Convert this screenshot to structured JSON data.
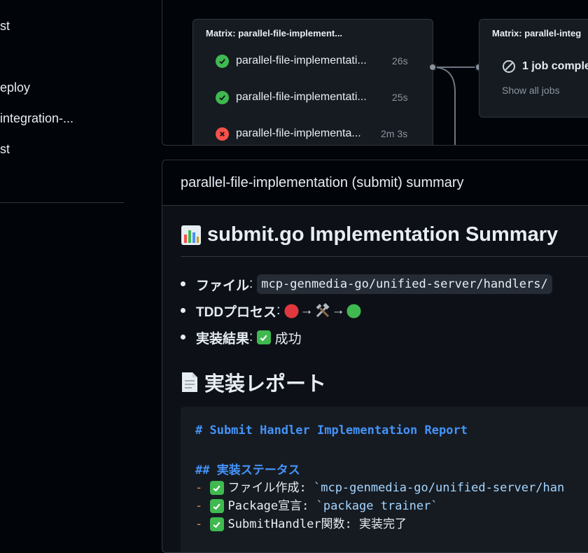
{
  "sidebar": {
    "items": [
      "st",
      "eploy",
      "integration-...",
      "st"
    ]
  },
  "graph": {
    "matrix1": {
      "title": "Matrix: parallel-file-implement...",
      "jobs": [
        {
          "name": "parallel-file-implementati...",
          "time": "26s",
          "status": "success"
        },
        {
          "name": "parallel-file-implementati...",
          "time": "25s",
          "status": "success"
        },
        {
          "name": "parallel-file-implementa...",
          "time": "2m 3s",
          "status": "failure"
        }
      ]
    },
    "matrix2": {
      "title": "Matrix: parallel-integ",
      "job_label": "1 job comple",
      "show_all": "Show all jobs"
    }
  },
  "summary": {
    "header": "parallel-file-implementation (submit) summary",
    "title": "submit.go Implementation Summary",
    "bullets": [
      {
        "label": "ファイル",
        "code": "mcp-genmedia-go/unified-server/handlers/"
      },
      {
        "label": "TDDプロセス",
        "value": "→ →"
      },
      {
        "label": "実装結果",
        "value": "成功"
      }
    ],
    "section_title": "実装レポート",
    "code": {
      "line1": "# Submit Handler Implementation Report",
      "line2": "## 実装ステータス",
      "line3_label": "ファイル作成: ",
      "line3_value": "`mcp-genmedia-go/unified-server/han",
      "line4_label": "Package宣言: ",
      "line4_value": "`package trainer`",
      "line5_label": "SubmitHandler関数: 実装完了",
      "dash": "-"
    }
  },
  "colors": {
    "success": "#3fb950",
    "failure": "#f85149",
    "accent_blue": "#4493f8"
  }
}
